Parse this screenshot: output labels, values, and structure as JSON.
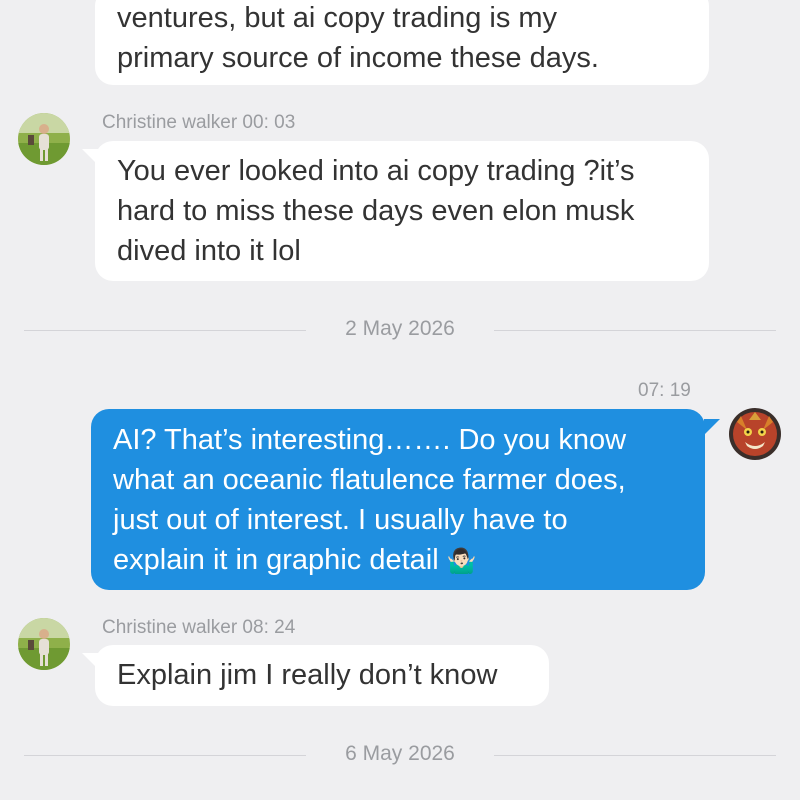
{
  "messages": [
    {
      "direction": "incoming",
      "lines": [
        "ventures, but ai copy trading is my",
        "primary source of income these days."
      ]
    },
    {
      "direction": "incoming",
      "sender": "Christine walker",
      "time": "00: 03",
      "meta": "Christine walker 00: 03",
      "lines": [
        "You ever looked into ai copy trading ?it’s",
        "hard to miss these days even elon musk",
        "dived into it lol"
      ]
    },
    {
      "direction": "outgoing",
      "time": "07: 19",
      "lines": [
        "AI? That’s interesting……. Do you know",
        "what an oceanic flatulence farmer does,",
        "just out of interest. I usually have to",
        "explain it in graphic detail"
      ],
      "emoji": "🤷🏻‍♂️"
    },
    {
      "direction": "incoming",
      "sender": "Christine walker",
      "time": "08: 24",
      "meta": "Christine walker 08: 24",
      "lines": [
        "Explain jim I really don’t know"
      ]
    }
  ],
  "date_separators": [
    "2 May 2026",
    "6 May 2026"
  ],
  "colors": {
    "background": "#efeff1",
    "incoming_bubble": "#ffffff",
    "outgoing_bubble": "#1f8fe0",
    "meta_text": "#9a9ca0"
  },
  "icons": {
    "contact_avatar": "christine-avatar-icon",
    "own_avatar": "dragon-avatar-icon"
  }
}
